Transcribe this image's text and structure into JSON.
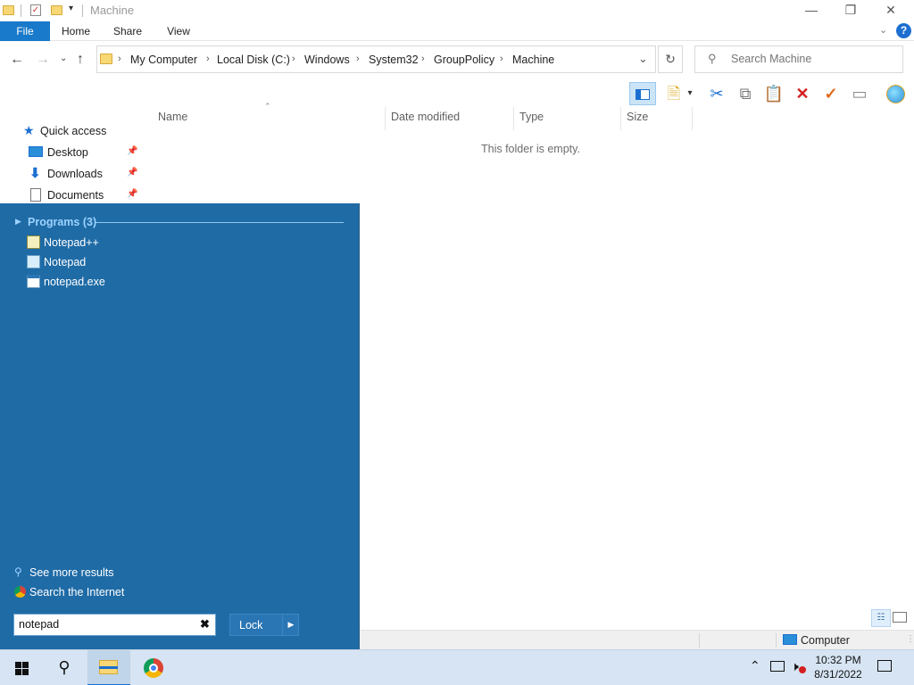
{
  "window": {
    "title": "Machine",
    "controls": [
      "minimize",
      "maximize",
      "close"
    ]
  },
  "ribbon": {
    "tabs": [
      "File",
      "Home",
      "Share",
      "View"
    ],
    "help_label": "?"
  },
  "address": {
    "breadcrumbs": [
      "My Computer",
      "Local Disk (C:)",
      "Windows",
      "System32",
      "GroupPolicy",
      "Machine"
    ],
    "search_placeholder": "Search Machine"
  },
  "nav_pane": {
    "quick_access": "Quick access",
    "items": [
      {
        "label": "Desktop",
        "icon": "desktop-icon"
      },
      {
        "label": "Downloads",
        "icon": "downloads-icon"
      },
      {
        "label": "Documents",
        "icon": "documents-icon"
      }
    ]
  },
  "file_list": {
    "columns": [
      "Name",
      "Date modified",
      "Type",
      "Size"
    ],
    "empty_message": "This folder is empty."
  },
  "status_bar": {
    "location": "Computer"
  },
  "start_menu": {
    "programs_header": "Programs (3)",
    "programs": [
      {
        "label": "Notepad++",
        "icon": "notepadpp-icon"
      },
      {
        "label": "Notepad",
        "icon": "notepad-icon"
      },
      {
        "label": "notepad.exe",
        "icon": "exe-icon"
      }
    ],
    "see_more": "See more results",
    "search_internet": "Search the Internet",
    "search_value": "notepad",
    "lock_label": "Lock"
  },
  "taskbar": {
    "time": "10:32 PM",
    "date": "8/31/2022"
  },
  "colors": {
    "accent": "#1979ca",
    "start_menu_bg": "#1f6ba6",
    "taskbar_bg": "#d6e4f3"
  }
}
